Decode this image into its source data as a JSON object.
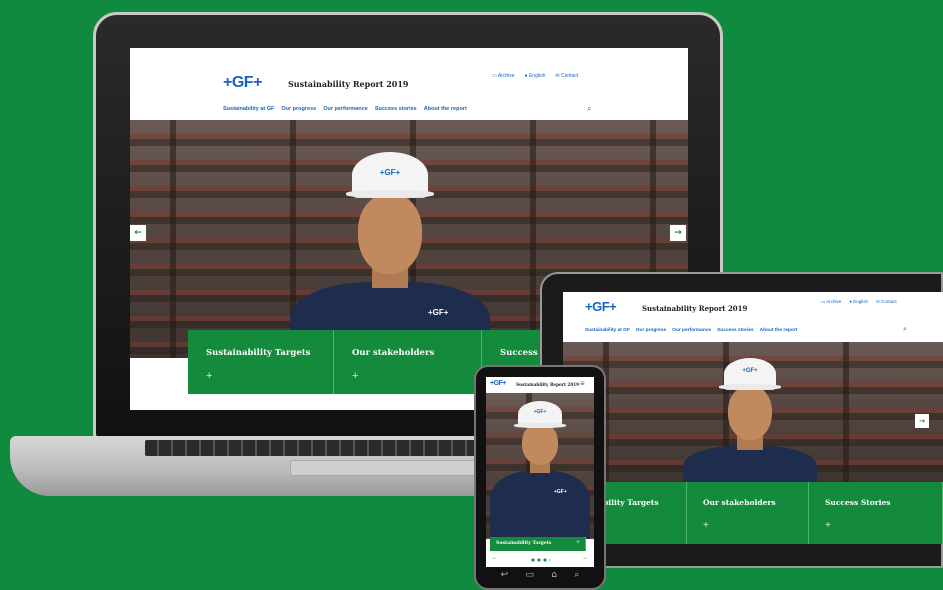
{
  "brand": {
    "logo": "+GF+",
    "accent": "#138a3c",
    "link": "#1565c0",
    "background": "#0f8a3e"
  },
  "site": {
    "title": "Sustainability Report 2019",
    "utility": [
      {
        "icon": "folder-icon",
        "label": "Archive"
      },
      {
        "icon": "globe-icon",
        "label": "English"
      },
      {
        "icon": "mail-icon",
        "label": "Contact"
      }
    ],
    "nav": [
      "Sustainability at GF",
      "Our progress",
      "Our performance",
      "Success stories",
      "About the report"
    ],
    "search_icon": "search-icon"
  },
  "laptop": {
    "tiles": [
      "Sustainability Targets",
      "Our stakeholders",
      "Success S"
    ]
  },
  "tablet": {
    "tiles": [
      "ainability Targets",
      "Our stakeholders",
      "Success Stories"
    ]
  },
  "phone": {
    "title": "Sustainability Report 2019",
    "tile": "Sustainability Targets"
  },
  "worker": {
    "helmet_logo": "+GF+",
    "shirt_logo": "+GF+"
  },
  "tile_plus": "+",
  "arrows": {
    "prev": "←",
    "next": "→"
  },
  "phone_nav": [
    "↩",
    "▭",
    "⌂",
    "⌕"
  ]
}
